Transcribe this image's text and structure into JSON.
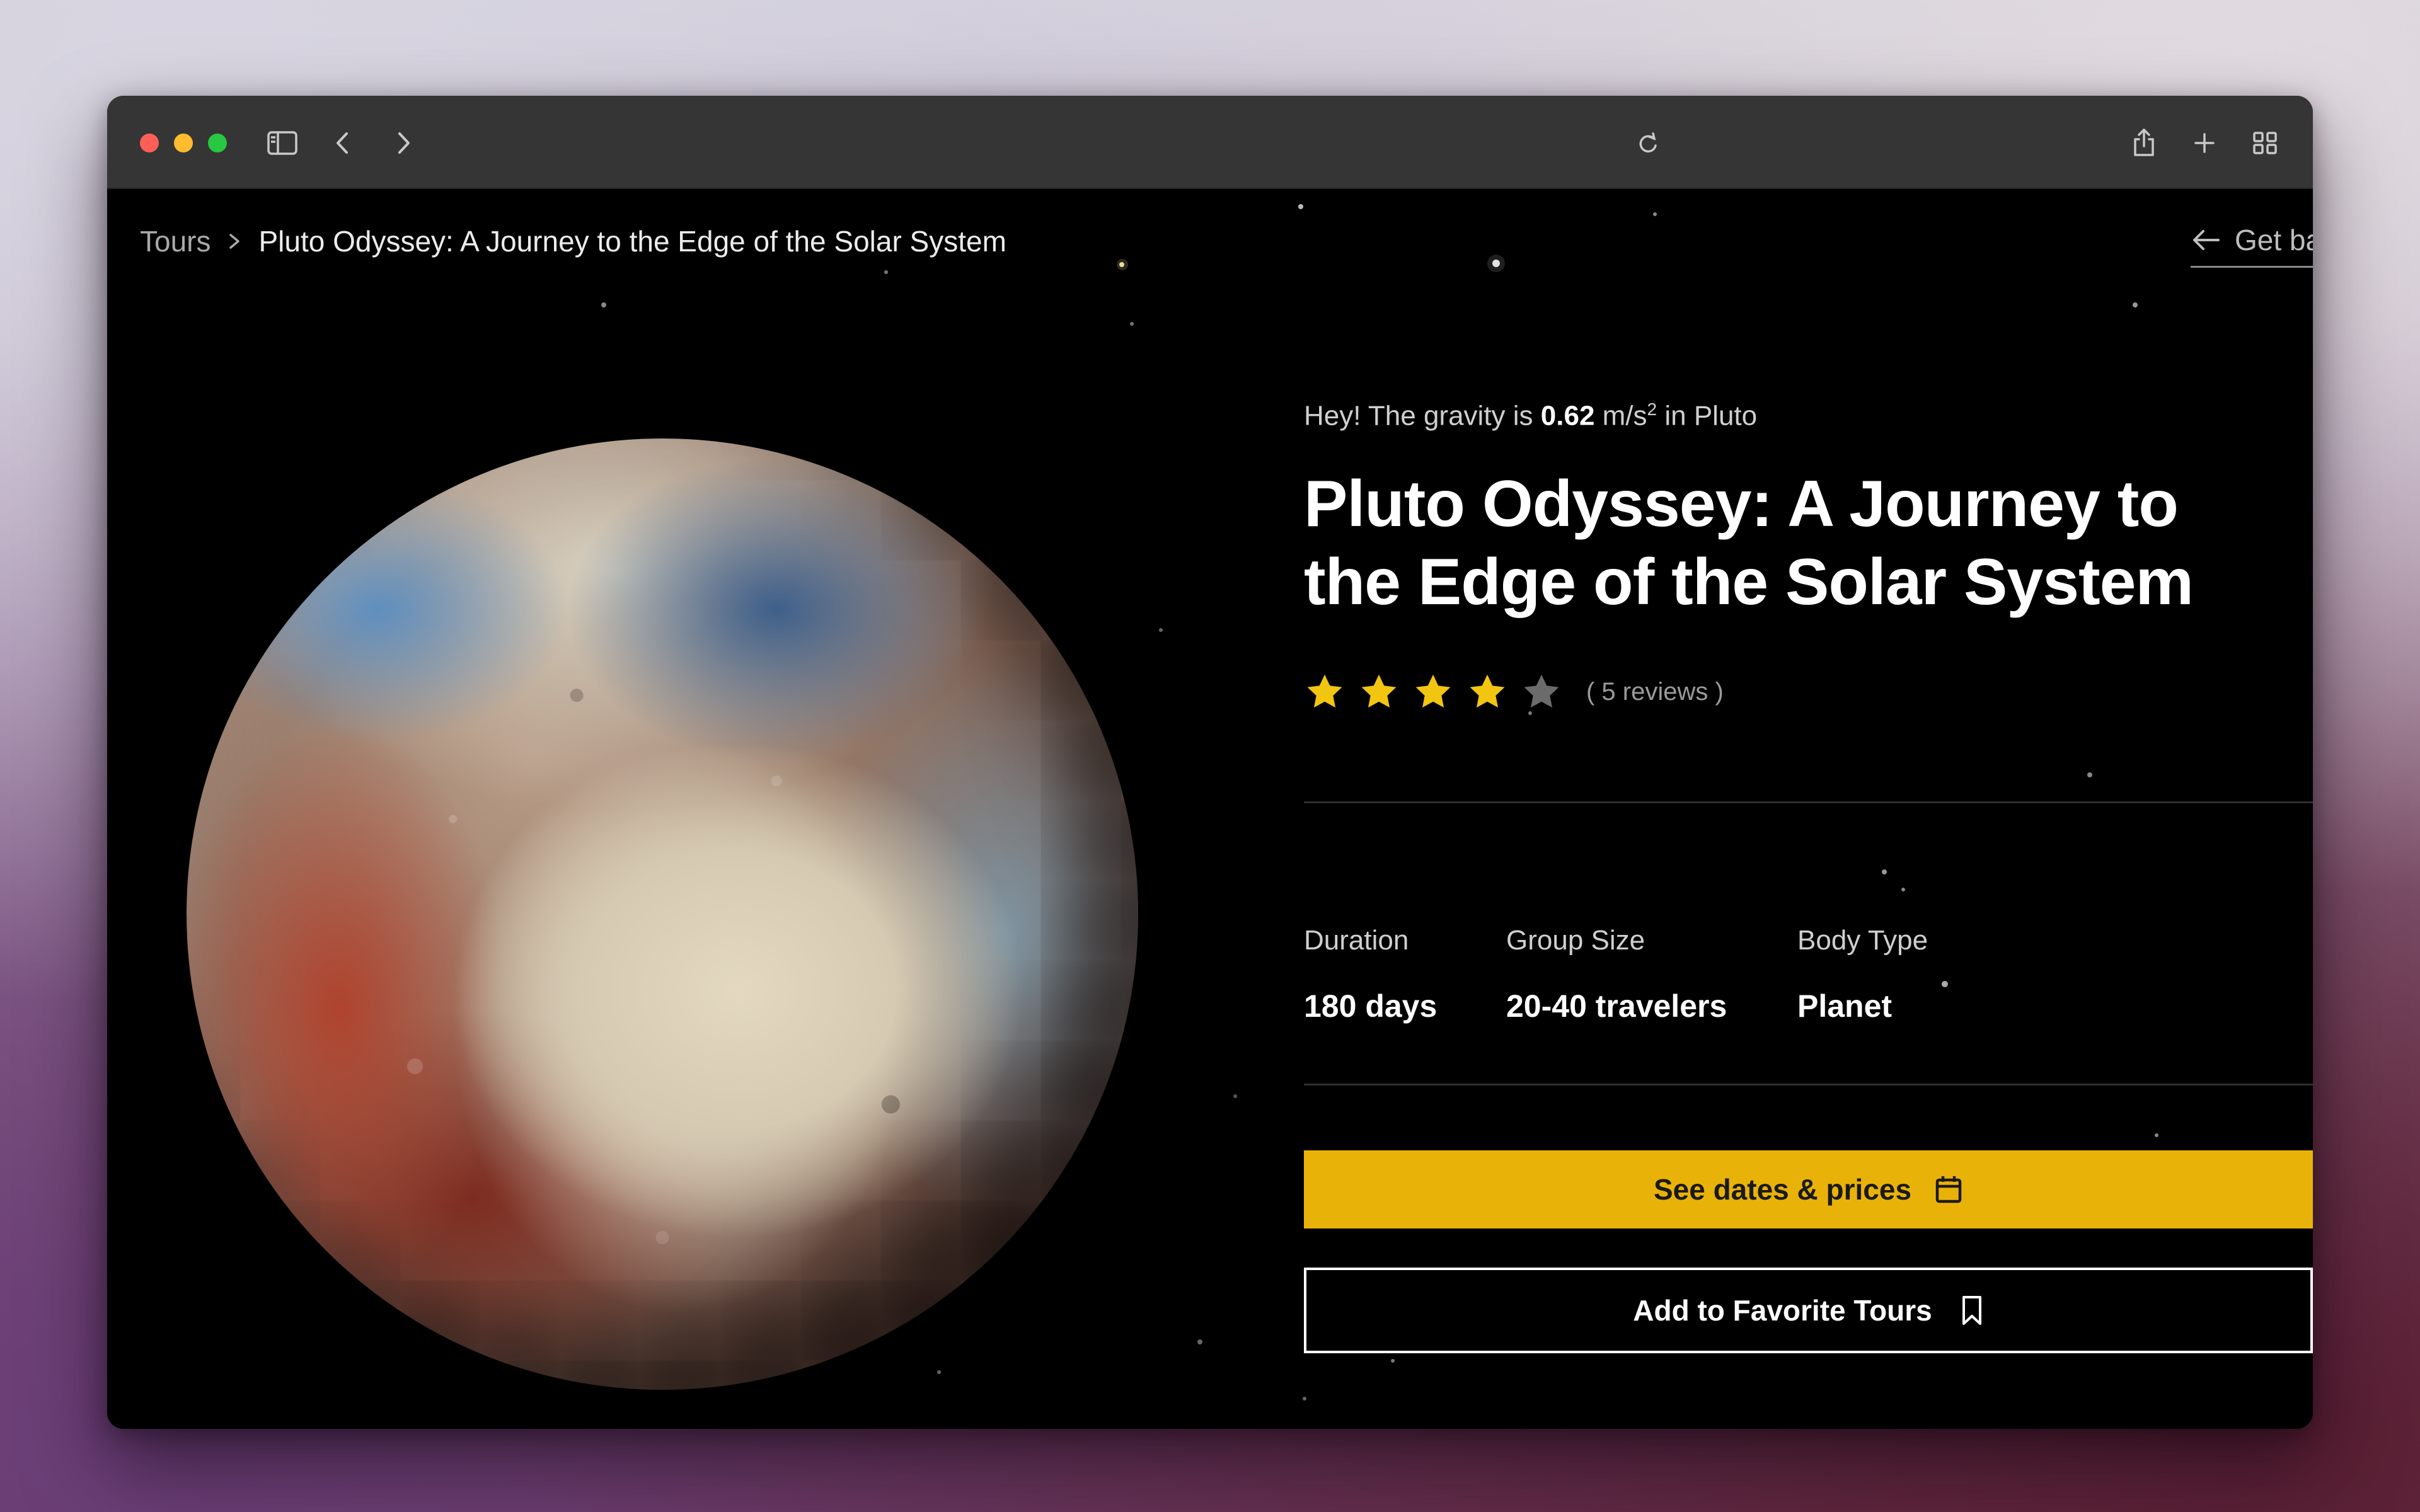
{
  "browser": {
    "toolbar_icons": [
      "sidebar-icon",
      "chevron-left-icon",
      "chevron-right-icon",
      "reload-icon",
      "share-icon",
      "plus-icon",
      "tab-overview-icon"
    ]
  },
  "breadcrumb": {
    "parent": "Tours",
    "current": "Pluto Odyssey: A Journey to the Edge of the Solar System"
  },
  "back_link": {
    "label": "Get ba"
  },
  "gravity": {
    "prefix": "Hey! The gravity is",
    "value": "0.62",
    "unit": "m/s",
    "exponent": "2",
    "suffix": "in Pluto"
  },
  "tour": {
    "title": "Pluto Odyssey: A Journey to the Edge of the Solar System",
    "rating": 4,
    "rating_max": 5,
    "reviews": "( 5 reviews )"
  },
  "stats": [
    {
      "label": "Duration",
      "value": "180 days"
    },
    {
      "label": "Group Size",
      "value": "20-40 travelers"
    },
    {
      "label": "Body Type",
      "value": "Planet"
    }
  ],
  "actions": {
    "primary": "See dates & prices",
    "secondary": "Add to Favorite Tours"
  },
  "colors": {
    "accent": "#e9b208",
    "star_filled": "#f2c511",
    "star_empty": "#6b6b6b",
    "page_background": "#000000"
  }
}
